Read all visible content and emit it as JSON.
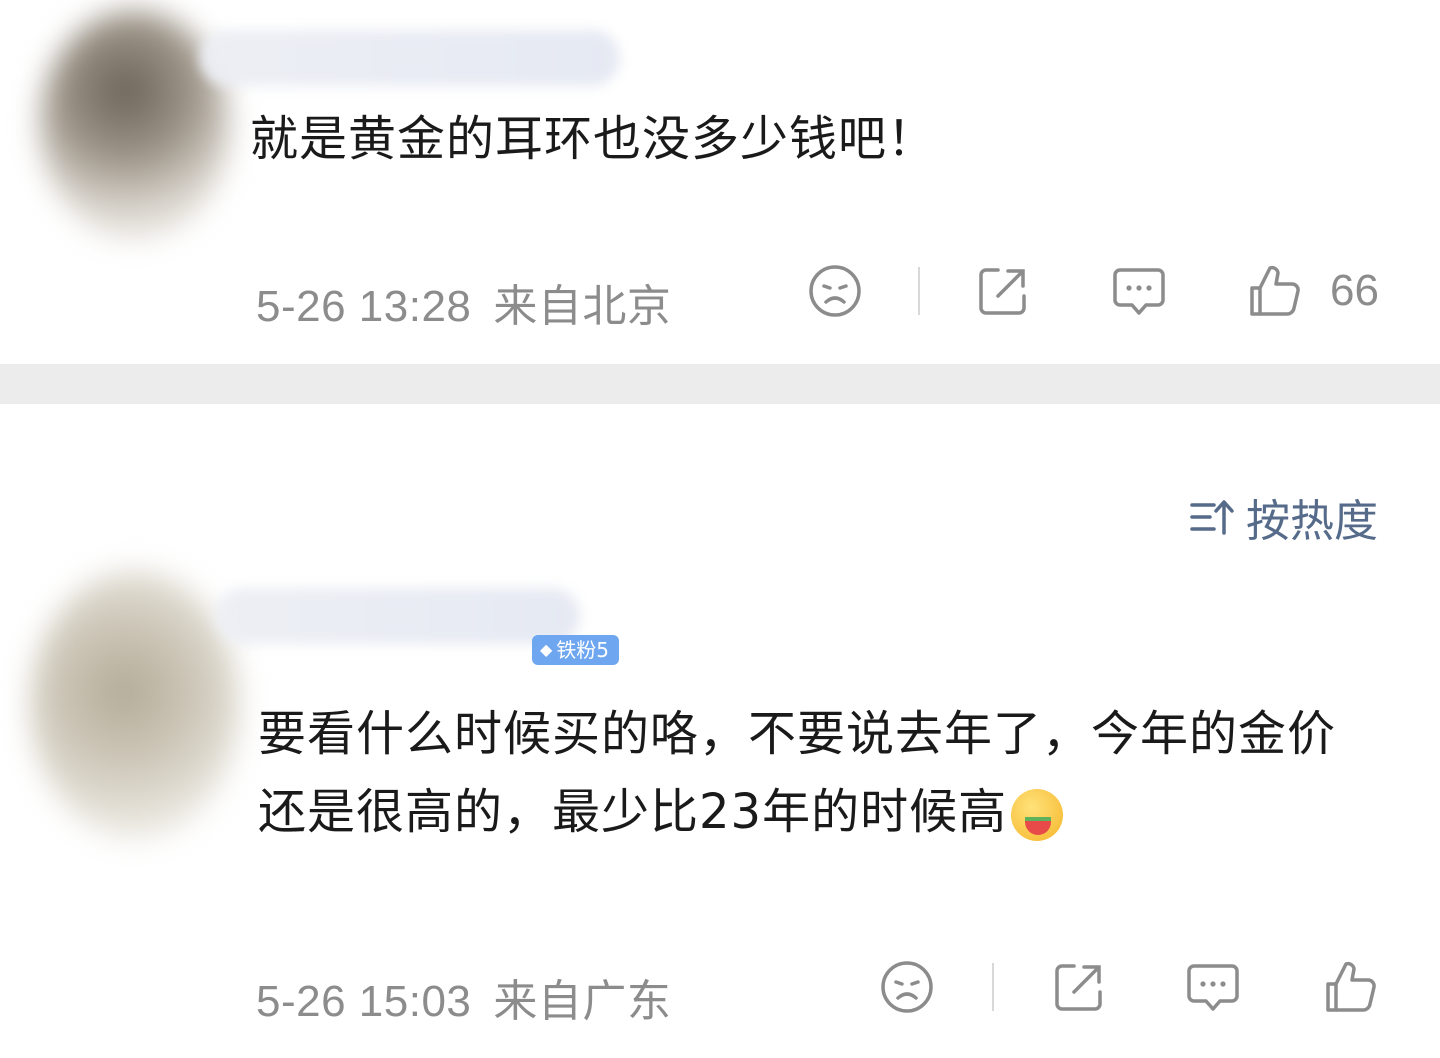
{
  "comments": [
    {
      "text": "就是黄金的耳环也没多少钱吧！",
      "time": "5-26 13:28",
      "location": "来自北京",
      "likes": "66"
    },
    {
      "badge": "铁粉5",
      "text": "要看什么时候买的咯，不要说去年了，今年的金价还是很高的，最少比23年的时候高",
      "time": "5-26 15:03",
      "location": "来自广东"
    }
  ],
  "sort": {
    "label": "按热度",
    "icon": "sort-up-icon"
  },
  "icons": {
    "dislike": "sad-face-icon",
    "share": "share-icon",
    "comment": "comment-icon",
    "like": "thumbs-up-icon"
  },
  "colors": {
    "meta_gray": "#8c8c8c",
    "sort_blue": "#566a8a",
    "badge_blue": "#6ea6f0"
  }
}
